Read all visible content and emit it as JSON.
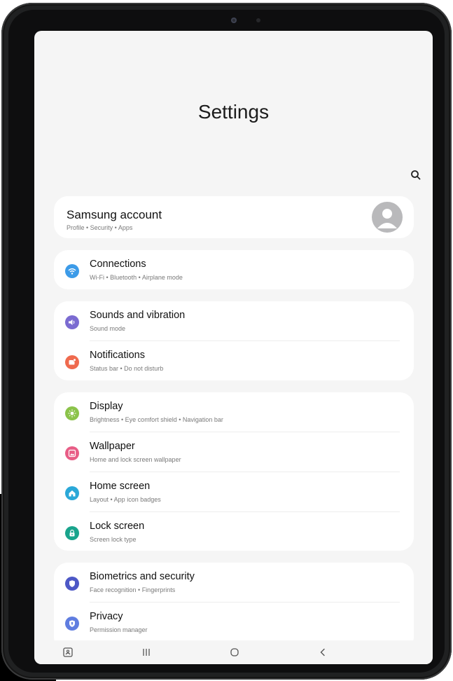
{
  "screen": {
    "title": "Settings"
  },
  "search": {
    "icon": "search-icon"
  },
  "account": {
    "label": "Samsung account",
    "sub": "Profile  •  Security  •  Apps",
    "icon": "avatar-icon"
  },
  "groups": [
    {
      "items": [
        {
          "label": "Connections",
          "sub": "Wi-Fi  •  Bluetooth  •  Airplane mode",
          "icon": "wifi-icon",
          "color": "#3c9be8"
        }
      ]
    },
    {
      "items": [
        {
          "label": "Sounds and vibration",
          "sub": "Sound mode",
          "icon": "speaker-icon",
          "color": "#7b6bd1"
        },
        {
          "label": "Notifications",
          "sub": "Status bar  •  Do not disturb",
          "icon": "notification-icon",
          "color": "#ef6a4e"
        }
      ]
    },
    {
      "items": [
        {
          "label": "Display",
          "sub": "Brightness  •  Eye comfort shield  •  Navigation bar",
          "icon": "sun-icon",
          "color": "#8bc34a"
        },
        {
          "label": "Wallpaper",
          "sub": "Home and lock screen wallpaper",
          "icon": "image-icon",
          "color": "#e85d86"
        },
        {
          "label": "Home screen",
          "sub": "Layout  •  App icon badges",
          "icon": "home-icon",
          "color": "#2aa8d8"
        },
        {
          "label": "Lock screen",
          "sub": "Screen lock type",
          "icon": "lock-icon",
          "color": "#19a48c"
        }
      ]
    },
    {
      "items": [
        {
          "label": "Biometrics and security",
          "sub": "Face recognition  •  Fingerprints",
          "icon": "shield-icon",
          "color": "#4d58c6"
        },
        {
          "label": "Privacy",
          "sub": "Permission manager",
          "icon": "privacy-icon",
          "color": "#5f7de0"
        }
      ]
    }
  ],
  "navbar": {
    "items": [
      "screenshot-icon",
      "recents-icon",
      "home-button-icon",
      "back-icon"
    ]
  }
}
